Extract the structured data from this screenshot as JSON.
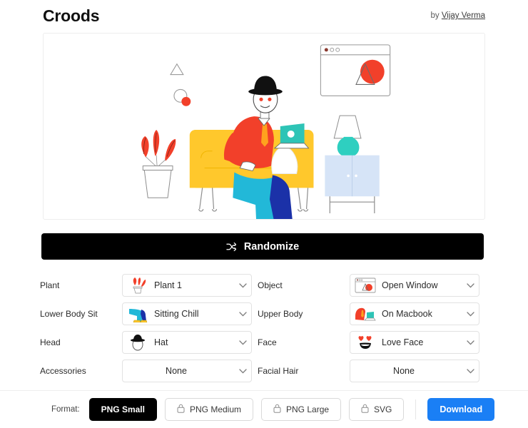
{
  "header": {
    "title": "Croods",
    "by_prefix": "by",
    "author": "Vijay Verma"
  },
  "illustration": {
    "scene_name": "person-sitting-on-sofa-with-laptop",
    "items": [
      "plant",
      "sofa",
      "character",
      "laptop",
      "lamp",
      "cabinet",
      "open-window",
      "triangle-shape",
      "circles-shape"
    ],
    "colors": {
      "sofa": "#FFC82C",
      "sweater": "#F2402A",
      "pants_front": "#22B8D8",
      "pants_back": "#1B31A8",
      "laptop": "#2EC4B6",
      "plant": "#F2402A",
      "cabinet": "#D6E4F7",
      "lamp_base": "#2ECFC0",
      "hat": "#111111",
      "shoes": "#FFC82C"
    }
  },
  "randomize": {
    "label": "Randomize",
    "icon": "shuffle-icon"
  },
  "controls": [
    {
      "label": "Plant",
      "value": "Plant 1",
      "icon": "plant-thumb-icon",
      "has_icon": true
    },
    {
      "label": "Object",
      "value": "Open Window",
      "icon": "open-window-thumb-icon",
      "has_icon": true
    },
    {
      "label": "Lower Body Sit",
      "value": "Sitting Chill",
      "icon": "sitting-legs-thumb-icon",
      "has_icon": true
    },
    {
      "label": "Upper Body",
      "value": "On Macbook",
      "icon": "on-macbook-thumb-icon",
      "has_icon": true
    },
    {
      "label": "Head",
      "value": "Hat",
      "icon": "hat-thumb-icon",
      "has_icon": true
    },
    {
      "label": "Face",
      "value": "Love Face",
      "icon": "love-face-thumb-icon",
      "has_icon": true
    },
    {
      "label": "Accessories",
      "value": "None",
      "icon": "",
      "has_icon": false
    },
    {
      "label": "Facial Hair",
      "value": "None",
      "icon": "",
      "has_icon": false
    }
  ],
  "footer": {
    "format_label": "Format:",
    "formats": [
      {
        "label": "PNG Small",
        "locked": false,
        "active": true
      },
      {
        "label": "PNG Medium",
        "locked": true,
        "active": false
      },
      {
        "label": "PNG Large",
        "locked": true,
        "active": false
      },
      {
        "label": "SVG",
        "locked": true,
        "active": false
      }
    ],
    "download_label": "Download",
    "accent_color": "#1a7ff5",
    "lock_icon": "lock-icon"
  }
}
